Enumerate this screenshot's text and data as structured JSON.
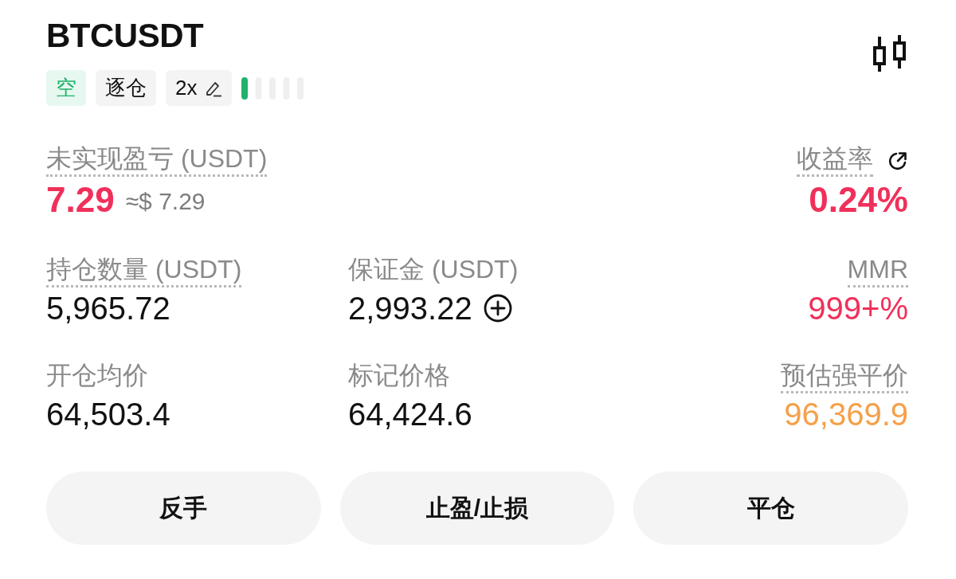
{
  "header": {
    "symbol": "BTCUSDT",
    "tags": [
      {
        "kind": "side",
        "label": "空"
      },
      {
        "kind": "mode",
        "label": "逐仓"
      },
      {
        "kind": "leverage",
        "label": "2x"
      }
    ],
    "adl": {
      "level": 0.2
    }
  },
  "metric_rows": [
    {
      "kind": "primary",
      "left": {
        "kind": "plain",
        "label": "未实现盈亏 (USDT)",
        "underlined": true,
        "value": "7.29",
        "secondary": "≈$ 7.29",
        "color": "#f0305a"
      },
      "right": {
        "kind": "share",
        "label": "收益率",
        "underlined": true,
        "value": "0.24%",
        "color": "#f0305a"
      }
    },
    {
      "kind": "normal",
      "left": {
        "kind": "plain",
        "label": "持仓数量 (USDT)",
        "underlined": true,
        "value": "5,965.72",
        "color": "#111111"
      },
      "middle": {
        "kind": "add",
        "label": "保证金 (USDT)",
        "underlined": false,
        "value": "2,993.22",
        "color": "#111111"
      },
      "right": {
        "kind": "plain",
        "label": "MMR",
        "underlined": true,
        "value": "999+%",
        "color": "#f0305a"
      }
    },
    {
      "kind": "normal",
      "left": {
        "kind": "plain",
        "label": "开仓均价",
        "underlined": false,
        "value": "64,503.4",
        "color": "#111111"
      },
      "middle": {
        "kind": "plain",
        "label": "标记价格",
        "underlined": false,
        "value": "64,424.6",
        "color": "#111111"
      },
      "right": {
        "kind": "plain",
        "label": "预估强平价",
        "underlined": true,
        "value": "96,369.9",
        "color": "#f5a04a"
      }
    }
  ],
  "buttons": [
    "反手",
    "止盈/止损",
    "平仓"
  ]
}
